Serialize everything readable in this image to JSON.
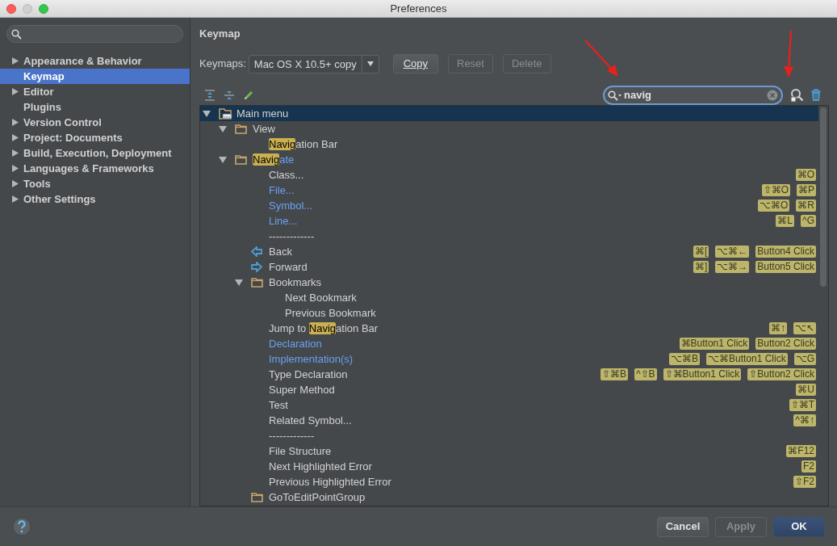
{
  "window": {
    "title": "Preferences"
  },
  "sidebar": {
    "items": [
      {
        "label": "Appearance & Behavior",
        "expandable": true,
        "selected": false
      },
      {
        "label": "Keymap",
        "expandable": false,
        "selected": true
      },
      {
        "label": "Editor",
        "expandable": true,
        "selected": false
      },
      {
        "label": "Plugins",
        "expandable": false,
        "selected": false
      },
      {
        "label": "Version Control",
        "expandable": true,
        "selected": false
      },
      {
        "label": "Project: Documents",
        "expandable": true,
        "selected": false
      },
      {
        "label": "Build, Execution, Deployment",
        "expandable": true,
        "selected": false
      },
      {
        "label": "Languages & Frameworks",
        "expandable": true,
        "selected": false
      },
      {
        "label": "Tools",
        "expandable": true,
        "selected": false
      },
      {
        "label": "Other Settings",
        "expandable": true,
        "selected": false
      }
    ]
  },
  "header": "Keymap",
  "keymaps": {
    "label": "Keymaps:",
    "value": "Mac OS X 10.5+ copy",
    "buttons": [
      {
        "label": "Copy",
        "disabled": false
      },
      {
        "label": "Reset",
        "disabled": true
      },
      {
        "label": "Delete",
        "disabled": true
      }
    ]
  },
  "filter": {
    "value": "navig"
  },
  "tree": [
    {
      "label": "Main menu",
      "kind": "menu",
      "expanded": true,
      "selected": true,
      "modified": false,
      "children": [
        {
          "label": "View",
          "kind": "folder",
          "expanded": true,
          "selected": false,
          "modified": false,
          "children": [
            {
              "parts": [
                {
                  "text": "Navig",
                  "match": true
                },
                {
                  "text": "ation Bar",
                  "match": false
                }
              ],
              "kind": "action",
              "selected": false,
              "modified": false
            }
          ]
        },
        {
          "parts": [
            {
              "text": "Navig",
              "match": true
            },
            {
              "text": "ate",
              "match": false
            }
          ],
          "kind": "folder",
          "expanded": true,
          "selected": false,
          "modified": true,
          "children": [
            {
              "label": "Class...",
              "kind": "action",
              "selected": false,
              "modified": false,
              "shortcuts": [
                "⌘O"
              ]
            },
            {
              "label": "File...",
              "kind": "action",
              "selected": false,
              "modified": true,
              "shortcuts": [
                "⇧⌘O",
                "⌘P"
              ]
            },
            {
              "label": "Symbol...",
              "kind": "action",
              "selected": false,
              "modified": true,
              "shortcuts": [
                "⌥⌘O",
                "⌘R"
              ]
            },
            {
              "label": "Line...",
              "kind": "action",
              "selected": false,
              "modified": true,
              "shortcuts": [
                "⌘L",
                "^G"
              ]
            },
            {
              "label": "-------------",
              "kind": "action",
              "selected": false,
              "modified": false
            },
            {
              "label": "Back",
              "kind": "back",
              "selected": false,
              "modified": false,
              "shortcuts": [
                "⌘[",
                "⌥⌘←",
                "Button4 Click"
              ]
            },
            {
              "label": "Forward",
              "kind": "forward",
              "selected": false,
              "modified": false,
              "shortcuts": [
                "⌘]",
                "⌥⌘→",
                "Button5 Click"
              ]
            },
            {
              "label": "Bookmarks",
              "kind": "folder",
              "expanded": true,
              "selected": false,
              "modified": false,
              "children": [
                {
                  "label": "Next Bookmark",
                  "kind": "action",
                  "selected": false,
                  "modified": false
                },
                {
                  "label": "Previous Bookmark",
                  "kind": "action",
                  "selected": false,
                  "modified": false
                }
              ]
            },
            {
              "parts": [
                {
                  "text": "Jump to ",
                  "match": false
                },
                {
                  "text": "Navig",
                  "match": true
                },
                {
                  "text": "ation Bar",
                  "match": false
                }
              ],
              "kind": "action",
              "selected": false,
              "modified": false,
              "shortcuts": [
                "⌘↑",
                "⌥↖"
              ]
            },
            {
              "label": "Declaration",
              "kind": "action",
              "selected": false,
              "modified": true,
              "shortcuts": [
                "⌘Button1 Click",
                "Button2 Click"
              ]
            },
            {
              "label": "Implementation(s)",
              "kind": "action",
              "selected": false,
              "modified": true,
              "shortcuts": [
                "⌥⌘B",
                "⌥⌘Button1 Click",
                "⌥G"
              ]
            },
            {
              "label": "Type Declaration",
              "kind": "action",
              "selected": false,
              "modified": false,
              "shortcuts": [
                "⇧⌘B",
                "^⇧B",
                "⇧⌘Button1 Click",
                "⇧Button2 Click"
              ]
            },
            {
              "label": "Super Method",
              "kind": "action",
              "selected": false,
              "modified": false,
              "shortcuts": [
                "⌘U"
              ]
            },
            {
              "label": "Test",
              "kind": "action",
              "selected": false,
              "modified": false,
              "shortcuts": [
                "⇧⌘T"
              ]
            },
            {
              "label": "Related Symbol...",
              "kind": "action",
              "selected": false,
              "modified": false,
              "shortcuts": [
                "^⌘↑"
              ]
            },
            {
              "label": "-------------",
              "kind": "action",
              "selected": false,
              "modified": false
            },
            {
              "label": "File Structure",
              "kind": "action",
              "selected": false,
              "modified": false,
              "shortcuts": [
                "⌘F12"
              ]
            },
            {
              "label": "Next Highlighted Error",
              "kind": "action",
              "selected": false,
              "modified": false,
              "shortcuts": [
                "F2"
              ]
            },
            {
              "label": "Previous Highlighted Error",
              "kind": "action",
              "selected": false,
              "modified": false,
              "shortcuts": [
                "⇧F2"
              ]
            },
            {
              "label": "GoToEditPointGroup",
              "kind": "folder",
              "selected": false,
              "modified": false
            }
          ]
        }
      ]
    }
  ],
  "footer": {
    "buttons": [
      {
        "label": "Cancel",
        "kind": "normal"
      },
      {
        "label": "Apply",
        "kind": "disabled"
      },
      {
        "label": "OK",
        "kind": "default"
      }
    ]
  }
}
